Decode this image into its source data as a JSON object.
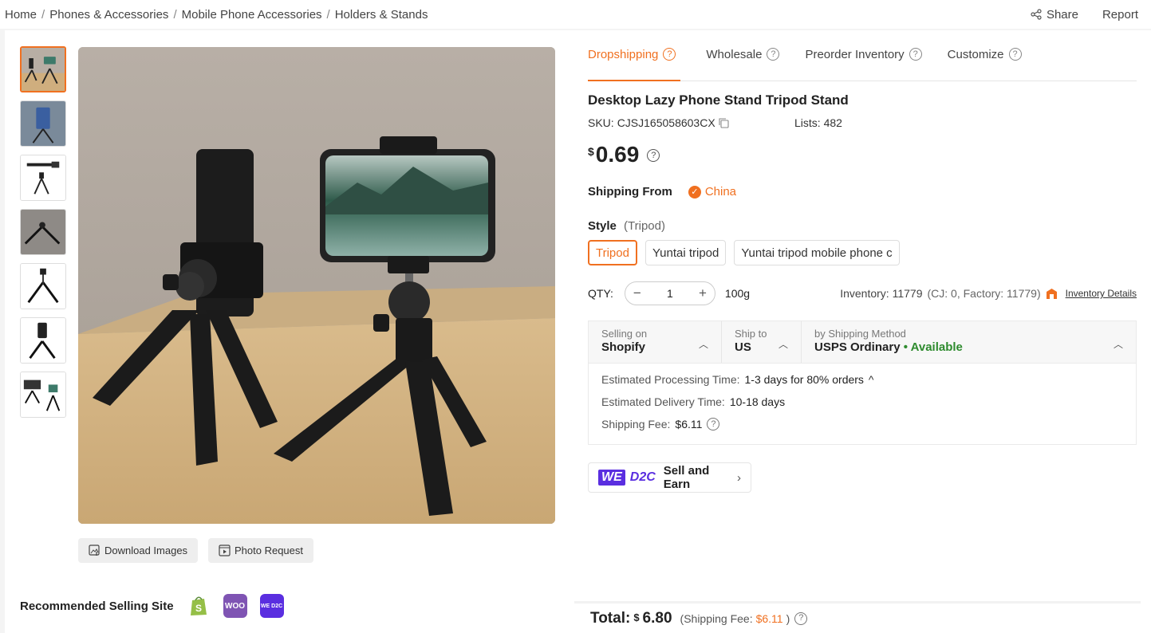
{
  "breadcrumb": [
    "Home",
    "Phones & Accessories",
    "Mobile Phone Accessories",
    "Holders & Stands"
  ],
  "breadcrumb_sep": "/",
  "top_actions": {
    "share": "Share",
    "report": "Report"
  },
  "tabs": [
    {
      "label": "Dropshipping",
      "active": true
    },
    {
      "label": "Wholesale",
      "active": false
    },
    {
      "label": "Preorder Inventory",
      "active": false
    },
    {
      "label": "Customize",
      "active": false
    }
  ],
  "product": {
    "title": "Desktop Lazy Phone Stand Tripod Stand",
    "sku_label": "SKU:",
    "sku": "CJSJ165058603CX",
    "lists_label": "Lists:",
    "lists": "482",
    "currency": "$",
    "price": "0.69"
  },
  "shipping_from": {
    "label": "Shipping From",
    "country": "China"
  },
  "style": {
    "label": "Style",
    "selected": "(Tripod)",
    "options": [
      "Tripod",
      "Yuntai tripod",
      "Yuntai tripod mobile phone c"
    ]
  },
  "qty": {
    "label": "QTY:",
    "minus": "−",
    "value": "1",
    "plus": "+",
    "weight": "100g",
    "inventory_label": "Inventory: 11779",
    "inventory_detail": "(CJ: 0, Factory: 11779)",
    "inventory_link": "Inventory Details"
  },
  "shipping": {
    "selling_on_label": "Selling on",
    "selling_on": "Shopify",
    "ship_to_label": "Ship to",
    "ship_to": "US",
    "method_label": "by Shipping Method",
    "method": "USPS Ordinary",
    "availability": "• Available",
    "processing_label": "Estimated Processing Time:",
    "processing": "1-3 days for 80% orders",
    "delivery_label": "Estimated Delivery Time:",
    "delivery": "10-18 days",
    "fee_label": "Shipping Fee:",
    "fee": "$6.11"
  },
  "wed2c": {
    "we": "WE",
    "d2c": "D2C",
    "label": "Sell and Earn"
  },
  "image_actions": {
    "download": "Download Images",
    "photo_request": "Photo Request"
  },
  "recommended": {
    "label": "Recommended Selling Site",
    "sites": [
      {
        "name": "shopify-icon",
        "text": "",
        "color": "#95bf47"
      },
      {
        "name": "woocommerce-icon",
        "text": "WOO",
        "color": "#7f54b3"
      },
      {
        "name": "wed2c-icon",
        "text": "WE D2C",
        "color": "#5a2ee0"
      }
    ]
  },
  "total": {
    "label": "Total:",
    "currency": "$",
    "amount": "6.80",
    "fee_prefix": "(Shipping Fee:",
    "fee": "$6.11",
    "fee_suffix": ")"
  },
  "colors": {
    "accent": "#f07020",
    "available": "#2e8b2e",
    "brand_purple": "#5a2ee0"
  }
}
